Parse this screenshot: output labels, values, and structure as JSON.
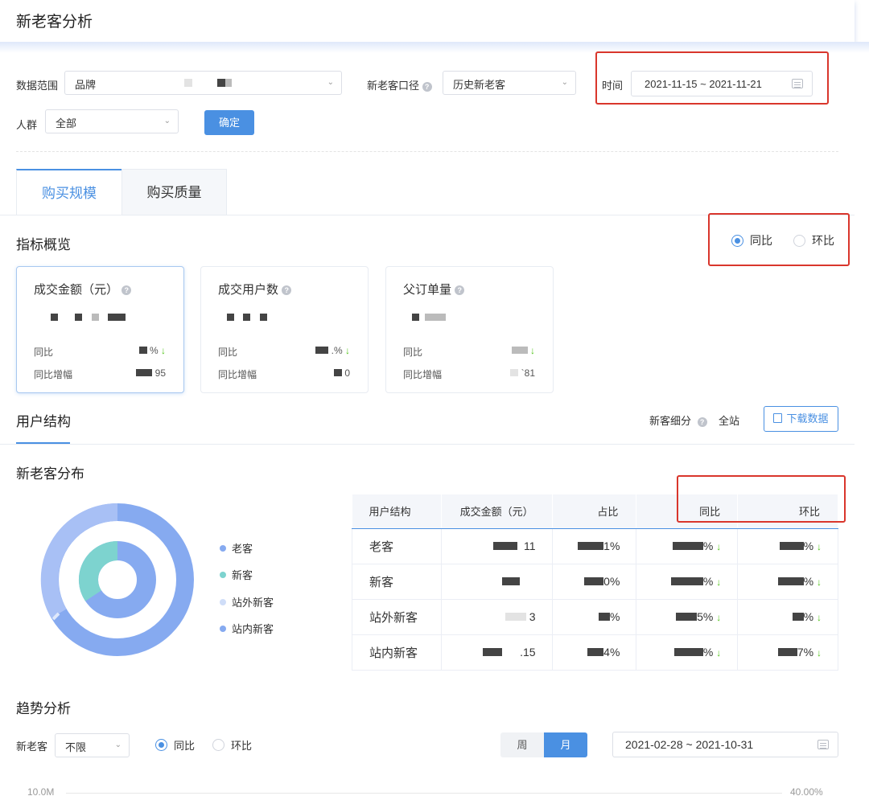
{
  "header": {
    "title": "新老客分析"
  },
  "filters": {
    "data_range_label": "数据范围",
    "data_range_value": "品牌",
    "caliber_label": "新老客口径",
    "caliber_value": "历史新老客",
    "time_label": "时间",
    "time_value": "2021-11-15 ~ 2021-11-21",
    "crowd_label": "人群",
    "crowd_value": "全部",
    "confirm_label": "确定"
  },
  "tabs": [
    {
      "label": "购买规模"
    },
    {
      "label": "购买质量"
    }
  ],
  "overview": {
    "title": "指标概览",
    "compare_yoy": "同比",
    "compare_mom": "环比",
    "selected_compare": "同比"
  },
  "metrics": [
    {
      "title": "成交金额（元）",
      "row1_label": "同比",
      "row1_tail": "%",
      "row2_label": "同比增幅",
      "row2_tail": "95"
    },
    {
      "title": "成交用户数",
      "row1_label": "同比",
      "row1_tail": ".%",
      "row2_label": "同比增幅",
      "row2_tail": "0"
    },
    {
      "title": "父订单量",
      "row1_label": "同比",
      "row1_tail": "",
      "row2_label": "同比增幅",
      "row2_tail": "`81"
    }
  ],
  "structure": {
    "title": "用户结构",
    "segment_label": "新客细分",
    "segment_value": "全站",
    "download_label": "下载数据"
  },
  "distribution": {
    "title": "新老客分布",
    "legend": [
      {
        "label": "老客",
        "color": "#86aaf0"
      },
      {
        "label": "新客",
        "color": "#7dd3cf"
      },
      {
        "label": "站外新客",
        "color": "#cfddf8"
      },
      {
        "label": "站内新客",
        "color": "#86aaf0"
      }
    ]
  },
  "table": {
    "headers": [
      "用户结构",
      "成交金额（元）",
      "占比",
      "同比",
      "环比"
    ],
    "rows": [
      {
        "name": "老客",
        "amount_tail": "11",
        "share_tail": "1%",
        "yoy_tail": "%",
        "mom_tail": "%"
      },
      {
        "name": "新客",
        "amount_tail": "",
        "share_tail": "0%",
        "yoy_tail": "%",
        "mom_tail": "%"
      },
      {
        "name": "站外新客",
        "amount_tail": "3",
        "share_tail": "%",
        "yoy_tail": "5%",
        "mom_tail": "%"
      },
      {
        "name": "站内新客",
        "amount_tail": ".15",
        "share_tail": "4%",
        "yoy_tail": "%",
        "mom_tail": "7%"
      }
    ]
  },
  "trend": {
    "title": "趋势分析",
    "filter_label": "新老客",
    "filter_value": "不限",
    "compare_yoy": "同比",
    "compare_mom": "环比",
    "week_label": "周",
    "month_label": "月",
    "date_range": "2021-02-28 ~ 2021-10-31",
    "y_left_top": "10.0M",
    "y_right_top": "40.00%"
  },
  "icons": {
    "down_arrow": "↓",
    "help": "?",
    "caret": "⌄"
  },
  "colors": {
    "primary": "#4a90e2",
    "down": "#52c41a",
    "highlight": "#d9362c"
  }
}
